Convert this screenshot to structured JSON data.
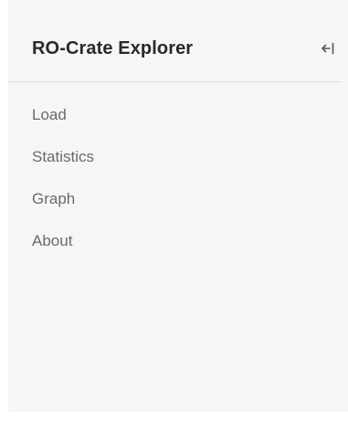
{
  "sidebar": {
    "title": "RO-Crate Explorer",
    "collapse_icon": "collapse-left-icon",
    "items": [
      {
        "label": "Load"
      },
      {
        "label": "Statistics"
      },
      {
        "label": "Graph"
      },
      {
        "label": "About"
      }
    ]
  },
  "colors": {
    "sidebar_bg": "#f6f6f6",
    "title": "#2a2a2a",
    "nav_text": "#6a6a6a",
    "divider": "#dedede"
  }
}
